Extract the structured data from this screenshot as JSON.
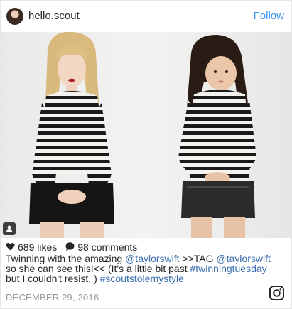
{
  "header": {
    "username": "hello.scout",
    "follow_label": "Follow"
  },
  "stats": {
    "likes": "689 likes",
    "comments": "98 comments"
  },
  "caption": {
    "part1": "Twinning with the amazing ",
    "mention1": "@taylorswift",
    "part2": " >>TAG ",
    "mention2": "@taylorswift",
    "part3": " so she can see this!<< (It's a little bit past ",
    "hashtag1": "#twinningtuesday",
    "part4": " but I couldn't resist. ) ",
    "hashtag2": "#scoutstolemystyle"
  },
  "date": "DECEMBER 29, 2016",
  "colors": {
    "follow": "#3897f0",
    "link": "#3b6fb0",
    "date": "#9b9b9b"
  },
  "icons": {
    "heart": "heart-icon",
    "comment": "comment-icon",
    "tag": "user-tag-icon",
    "logo": "instagram-logo-icon"
  }
}
